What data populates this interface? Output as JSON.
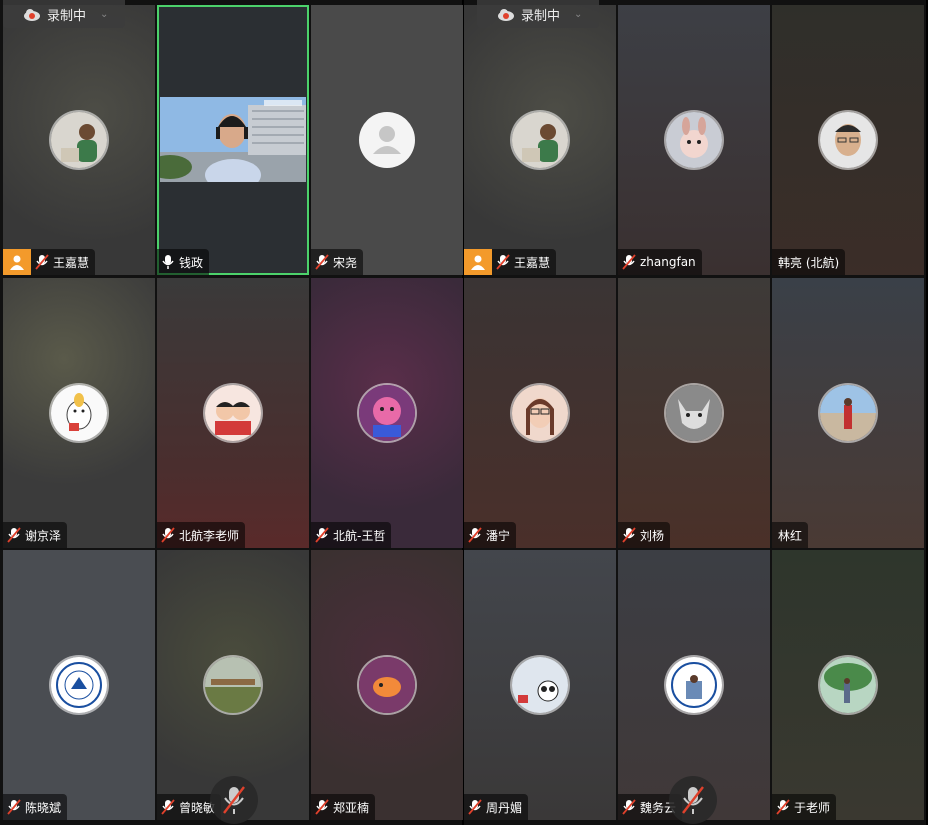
{
  "recording": {
    "label": "录制中"
  },
  "left_panel": {
    "tiles": [
      {
        "name": "王嘉慧",
        "host": true,
        "muted": true
      },
      {
        "name": "钱政",
        "host": false,
        "muted": false,
        "video": true
      },
      {
        "name": "宋尧",
        "host": false,
        "muted": true
      },
      {
        "name": "谢京泽",
        "host": false,
        "muted": true
      },
      {
        "name": "北航李老师",
        "host": false,
        "muted": true
      },
      {
        "name": "北航-王哲",
        "host": false,
        "muted": true
      },
      {
        "name": "陈晓斌",
        "host": false,
        "muted": true
      },
      {
        "name": "曾晓敏",
        "host": false,
        "muted": true
      },
      {
        "name": "郑亚楠",
        "host": false,
        "muted": true
      }
    ]
  },
  "right_panel": {
    "tiles": [
      {
        "name": "王嘉慧",
        "host": true,
        "muted": true
      },
      {
        "name": "zhangfan",
        "host": false,
        "muted": true
      },
      {
        "name": "韩亮 (北航)",
        "host": false,
        "muted": false
      },
      {
        "name": "潘宁",
        "host": false,
        "muted": true
      },
      {
        "name": "刘杨",
        "host": false,
        "muted": true
      },
      {
        "name": "林红",
        "host": false,
        "muted": false
      },
      {
        "name": "周丹媚",
        "host": false,
        "muted": true
      },
      {
        "name": "魏务云",
        "host": false,
        "muted": true
      },
      {
        "name": "于老师",
        "host": false,
        "muted": true
      }
    ]
  },
  "colors": {
    "active_speaker": "#4cd26b",
    "host_badge": "#f39a2b",
    "muted_slash": "#e0412c"
  }
}
